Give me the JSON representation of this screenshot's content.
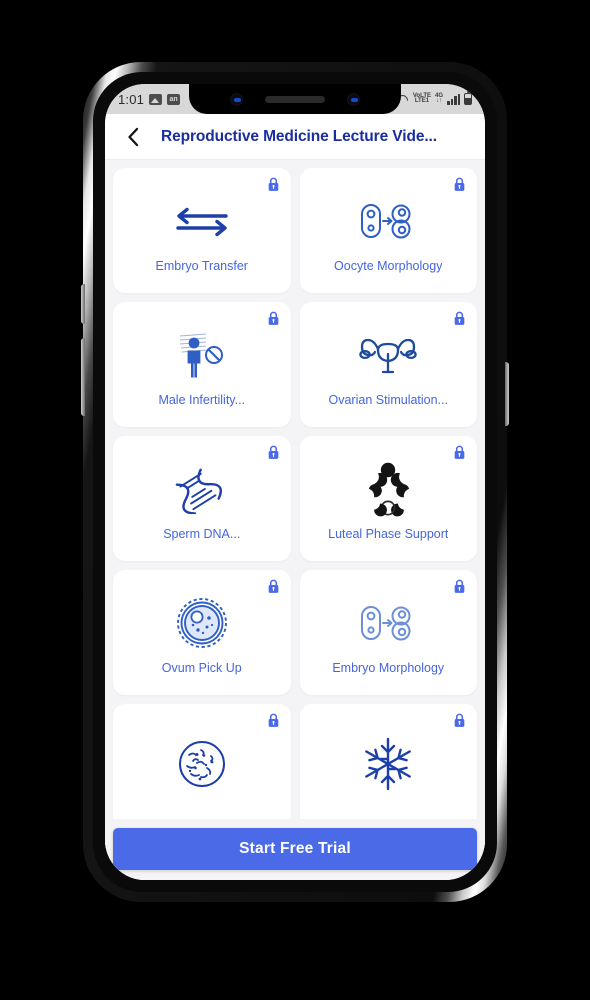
{
  "statusbar": {
    "time": "1:01",
    "left_icons": [
      "photo-icon",
      "gallery-icon"
    ],
    "network_volte": "VoLTE",
    "network_volte_sub": "LTE1",
    "network_gen": "4G",
    "network_gen_sub": "↓↑",
    "right_icons": [
      "wifi-calling-icon",
      "signal-bars-icon",
      "battery-icon"
    ]
  },
  "appbar": {
    "back_icon": "chevron-left-icon",
    "title": "Reproductive Medicine Lecture Vide...",
    "title_color": "#1b2ea0"
  },
  "grid": {
    "lock_icon": "lock-icon",
    "items": [
      {
        "label": "Embryo Transfer",
        "icon": "double-arrow-icon",
        "locked": true
      },
      {
        "label": "Oocyte Morphology",
        "icon": "cell-division-icon",
        "locked": true
      },
      {
        "label": "Male Infertility...",
        "icon": "male-infertility-icon",
        "locked": true
      },
      {
        "label": "Ovarian Stimulation...",
        "icon": "uterus-icon",
        "locked": true
      },
      {
        "label": "Sperm DNA...",
        "icon": "dna-helix-icon",
        "locked": true
      },
      {
        "label": "Luteal Phase Support",
        "icon": "moon-phases-icon",
        "locked": true
      },
      {
        "label": "Ovum Pick Up",
        "icon": "oocyte-cell-icon",
        "locked": true
      },
      {
        "label": "Embryo Morphology",
        "icon": "cell-division-icon",
        "locked": true
      },
      {
        "label": "",
        "icon": "petri-dish-icon",
        "locked": true
      },
      {
        "label": "",
        "icon": "snowflake-icon",
        "locked": true
      }
    ]
  },
  "cta": {
    "label": "Start Free Trial",
    "color": "#4a6ae8"
  },
  "navbar": {
    "recents_label": "recents-icon",
    "home_label": "home-icon",
    "back_label": "back-icon"
  },
  "theme": {
    "accent_blue": "#4565dd",
    "title_navy": "#1b2ea0",
    "icon_blue": "#2b53b8",
    "card_bg": "#ffffff",
    "page_bg": "#f4f4f6"
  }
}
